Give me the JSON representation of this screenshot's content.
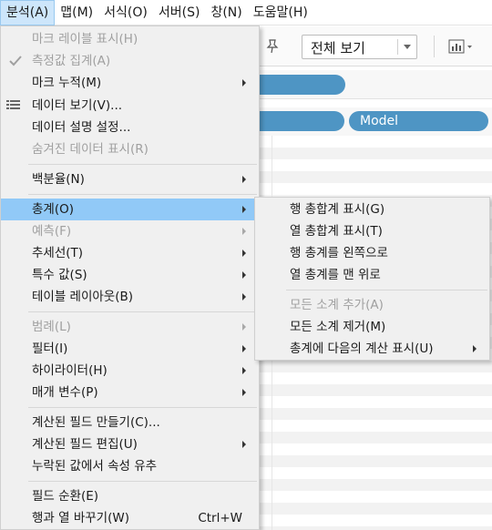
{
  "menubar": {
    "items": [
      "분석(A)",
      "맵(M)",
      "서식(O)",
      "서버(S)",
      "창(N)",
      "도움말(H)"
    ]
  },
  "toolbar": {
    "view_dropdown_label": "전체 보기"
  },
  "shelves": {
    "row_pill": "",
    "col_pill": "Model"
  },
  "analysis_menu": {
    "items": [
      {
        "label": "마크 레이블 표시(H)",
        "enabled": false
      },
      {
        "label": "측정값 집계(A)",
        "enabled": false,
        "checked": true
      },
      {
        "label": "마크 누적(M)",
        "enabled": true,
        "submenu": true
      },
      {
        "label": "데이터 보기(V)...",
        "enabled": true,
        "icon": "table-list-icon"
      },
      {
        "label": "데이터 설명 설정...",
        "enabled": true
      },
      {
        "label": "숨겨진 데이터 표시(R)",
        "enabled": false
      },
      {
        "label": "백분율(N)",
        "enabled": true,
        "submenu": true
      },
      {
        "label": "총계(O)",
        "enabled": true,
        "submenu": true,
        "highlighted": true
      },
      {
        "label": "예측(F)",
        "enabled": false,
        "submenu": true
      },
      {
        "label": "추세선(T)",
        "enabled": true,
        "submenu": true
      },
      {
        "label": "특수 값(S)",
        "enabled": true,
        "submenu": true
      },
      {
        "label": "테이블 레이아웃(B)",
        "enabled": true,
        "submenu": true
      },
      {
        "label": "범례(L)",
        "enabled": false,
        "submenu": true
      },
      {
        "label": "필터(I)",
        "enabled": true,
        "submenu": true
      },
      {
        "label": "하이라이터(H)",
        "enabled": true,
        "submenu": true
      },
      {
        "label": "매개 변수(P)",
        "enabled": true,
        "submenu": true
      },
      {
        "label": "계산된 필드 만들기(C)...",
        "enabled": true
      },
      {
        "label": "계산된 필드 편집(U)",
        "enabled": true,
        "submenu": true
      },
      {
        "label": "누락된 값에서 속성 유추",
        "enabled": true
      },
      {
        "label": "필드 순환(E)",
        "enabled": true
      },
      {
        "label": "행과 열 바꾸기(W)",
        "enabled": true,
        "shortcut": "Ctrl+W"
      }
    ]
  },
  "totals_submenu": {
    "items": [
      {
        "label": "행 총합계 표시(G)",
        "enabled": true
      },
      {
        "label": "열 총합계 표시(T)",
        "enabled": true
      },
      {
        "label": "행 총계를 왼쪽으로",
        "enabled": true
      },
      {
        "label": "열 총계를 맨 위로",
        "enabled": true
      },
      {
        "label": "모든 소계 추가(A)",
        "enabled": false
      },
      {
        "label": "모든 소계 제거(M)",
        "enabled": true
      },
      {
        "label": "총계에 다음의 계산 표시(U)",
        "enabled": true,
        "submenu": true
      }
    ]
  }
}
